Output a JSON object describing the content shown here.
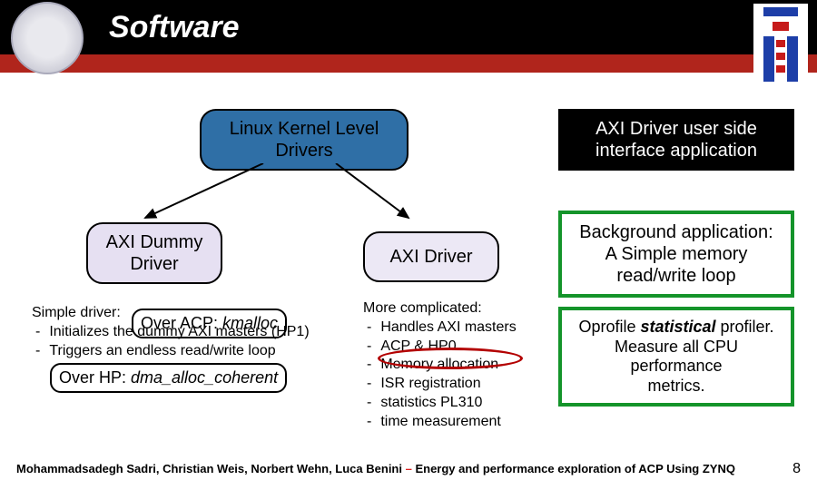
{
  "header": {
    "title": "Software"
  },
  "nodes": {
    "kernel": "Linux Kernel Level\nDrivers",
    "userapp": "AXI Driver user side\ninterface application",
    "dummy": "AXI Dummy\nDriver",
    "driver": "AXI Driver",
    "bgapp": "Background application:\nA Simple memory\nread/write loop",
    "oprofile": "Oprofile statistical profiler.\nMeasure all CPU performance\nmetrics."
  },
  "simple": {
    "head": "Simple driver:",
    "items": [
      "Initializes the dummy AXI masters (HP1)",
      "Triggers an endless read/write loop"
    ]
  },
  "overlays": {
    "acp": "Over ACP: kmalloc",
    "hp": "Over HP: dma_alloc_coherent"
  },
  "more": {
    "head": "More complicated:",
    "items": [
      "Handles AXI masters",
      "ACP & HP0",
      "Memory allocation",
      "ISR registration",
      "statistics PL310",
      "time measurement"
    ]
  },
  "footer": {
    "authors": "Mohammadsadegh Sadri, Christian Weis, Norbert Wehn, Luca Benini",
    "dash": " – ",
    "topic": "Energy and performance exploration of ACP  Using ZYNQ",
    "page": "8"
  }
}
